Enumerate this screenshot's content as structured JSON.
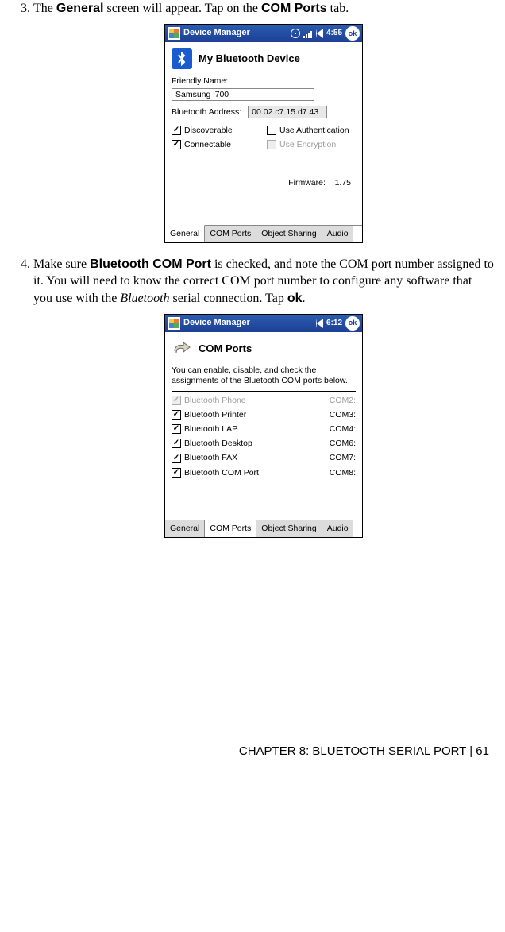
{
  "steps": {
    "s3": {
      "pre": "The ",
      "bold1": "General",
      "mid": " screen will appear. Tap on the ",
      "bold2": "COM Ports",
      "post": " tab."
    },
    "s4": {
      "pre": "Make sure ",
      "bold1": "Bluetooth COM Port",
      "mid1": " is checked, and note the COM port number assigned to it. You will need to know the correct COM port number to configure any software that you use with the ",
      "ital": "Bluetooth",
      "mid2": " serial connection. Tap ",
      "bold2": "ok",
      "post": "."
    }
  },
  "shot1": {
    "title": "Device Manager",
    "time": "4:55",
    "ok": "ok",
    "heading": "My Bluetooth Device",
    "friendly_label": "Friendly Name:",
    "friendly_value": "Samsung i700",
    "bt_addr_label": "Bluetooth Address:",
    "bt_addr_value": "00.02.c7.15.d7.43",
    "chk_discoverable": "Discoverable",
    "chk_connectable": "Connectable",
    "chk_auth": "Use Authentication",
    "chk_enc": "Use Encryption",
    "firmware_label": "Firmware:",
    "firmware_value": "1.75",
    "tabs": {
      "general": "General",
      "com": "COM Ports",
      "obj": "Object Sharing",
      "audio": "Audio"
    }
  },
  "shot2": {
    "title": "Device Manager",
    "time": "6:12",
    "ok": "ok",
    "heading": "COM Ports",
    "desc": "You can enable, disable, and check the assignments of the Bluetooth COM ports below.",
    "rows": [
      {
        "name": "Bluetooth Phone",
        "port": "COM2:",
        "checked": true,
        "disabled": true
      },
      {
        "name": "Bluetooth Printer",
        "port": "COM3:",
        "checked": true,
        "disabled": false
      },
      {
        "name": "Bluetooth LAP",
        "port": "COM4:",
        "checked": true,
        "disabled": false
      },
      {
        "name": "Bluetooth Desktop",
        "port": "COM6:",
        "checked": true,
        "disabled": false
      },
      {
        "name": "Bluetooth FAX",
        "port": "COM7:",
        "checked": true,
        "disabled": false
      },
      {
        "name": "Bluetooth COM Port",
        "port": "COM8:",
        "checked": true,
        "disabled": false
      }
    ],
    "tabs": {
      "general": "General",
      "com": "COM Ports",
      "obj": "Object Sharing",
      "audio": "Audio"
    }
  },
  "footer": {
    "text": "CHAPTER 8: BLUETOOTH SERIAL PORT | 61"
  }
}
